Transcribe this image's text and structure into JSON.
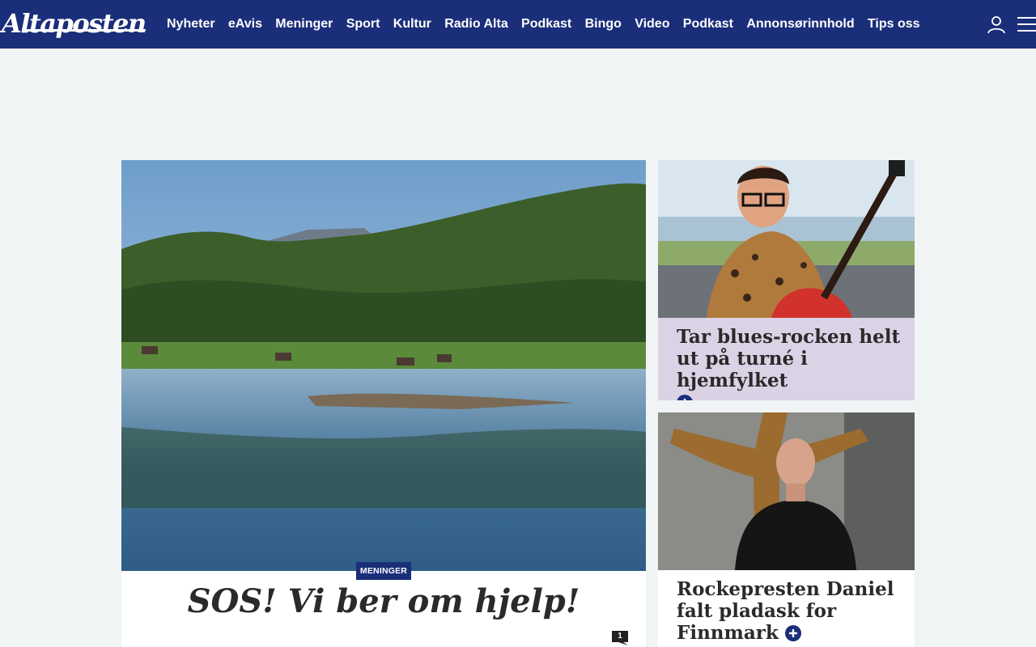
{
  "header": {
    "logo_text": "Altaposten",
    "nav": [
      "Nyheter",
      "eAvis",
      "Meninger",
      "Sport",
      "Kultur",
      "Radio Alta",
      "Podkast",
      "Bingo",
      "Video",
      "Podkast",
      "Annonsørinnhold",
      "Tips oss"
    ],
    "icons": [
      "user-icon",
      "menu-icon"
    ]
  },
  "main_article": {
    "category": "MENINGER",
    "title": "SOS! Vi ber om hjelp!",
    "comment_count": "1"
  },
  "side_articles": [
    {
      "title": "Tar blues-rocken helt ut på turné i hjemfylket",
      "icon": "plus-icon"
    },
    {
      "title": "Rockepresten Daniel falt pladask for Finnmark",
      "icon": "plus-icon"
    }
  ],
  "colors": {
    "brand": "#1b2e7a",
    "background": "#f1f4f5",
    "side_highlight": "#dcd2e6"
  }
}
